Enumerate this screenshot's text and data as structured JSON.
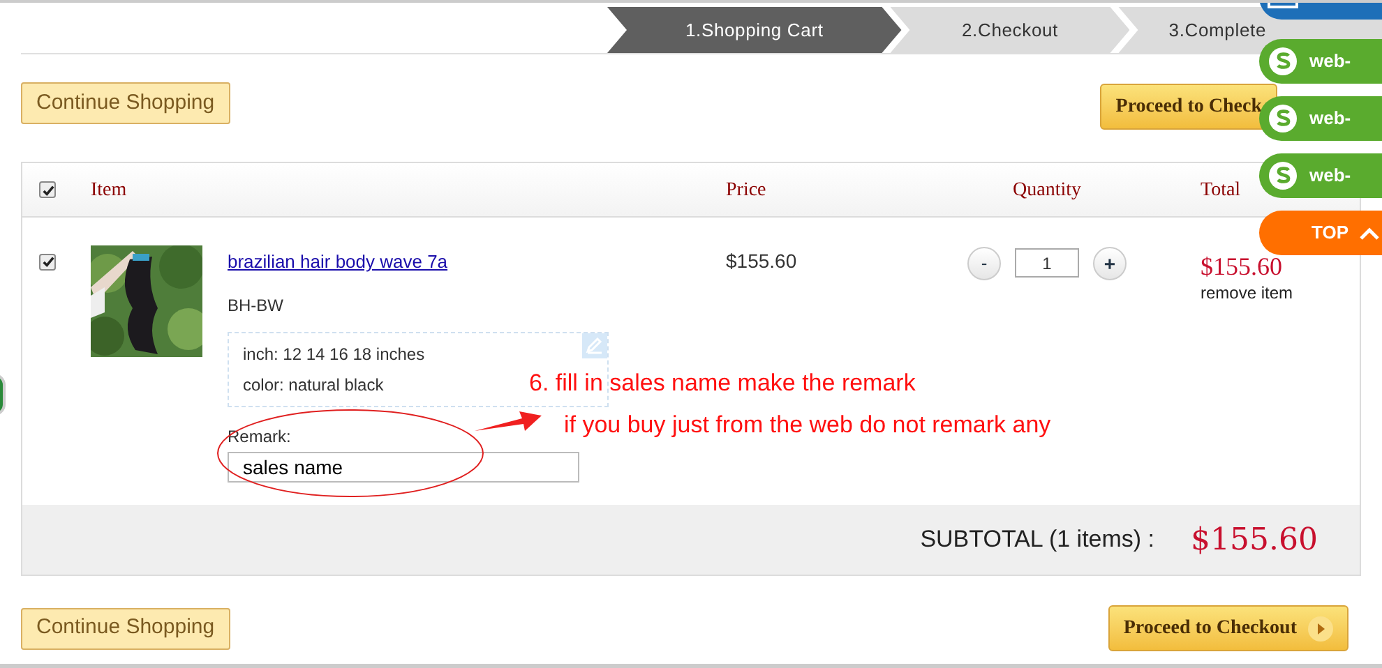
{
  "steps": [
    {
      "label": "1.Shopping Cart",
      "selected": true
    },
    {
      "label": "2.Checkout",
      "selected": false
    },
    {
      "label": "3.Complete",
      "selected": false
    }
  ],
  "top_buttons": {
    "continue": "Continue Shopping",
    "checkout": "Proceed to Check"
  },
  "table": {
    "select_all_checked": true,
    "columns": [
      "Item",
      "Price",
      "Quantity",
      "Total"
    ],
    "rows": [
      {
        "checked": true,
        "kind": "picture",
        "name": "brazilian hair body wave 7a",
        "sku": "BH-BW",
        "options": [
          "inch: 12 14 16 18 inches",
          "color: natural black"
        ],
        "remark_label": "Remark:",
        "remark_value": "sales name",
        "price": "$155.60",
        "quantity": "1",
        "minus": "-",
        "plus": "+",
        "total": "$155.60",
        "remove": "remove item"
      }
    ],
    "subtotal_label": "SUBTOTAL (1 items) :",
    "subtotal": "$155.60"
  },
  "bottom_buttons": {
    "continue": "Continue Shopping",
    "checkout": "Proceed to Checkout"
  },
  "annotation": [
    "6. fill in sales name make the remark",
    "if you buy just from the web do not remark any"
  ],
  "side_widgets": [
    {
      "kind": "mail",
      "color": "#1e6fb8"
    },
    {
      "kind": "skype",
      "label": "web-",
      "color": "#5aab2e"
    },
    {
      "kind": "skype",
      "label": "web-",
      "color": "#5aab2e"
    },
    {
      "kind": "skype",
      "label": "web-",
      "color": "#5aab2e"
    },
    {
      "kind": "top",
      "label": "TOP",
      "color": "#ff6f00"
    }
  ]
}
